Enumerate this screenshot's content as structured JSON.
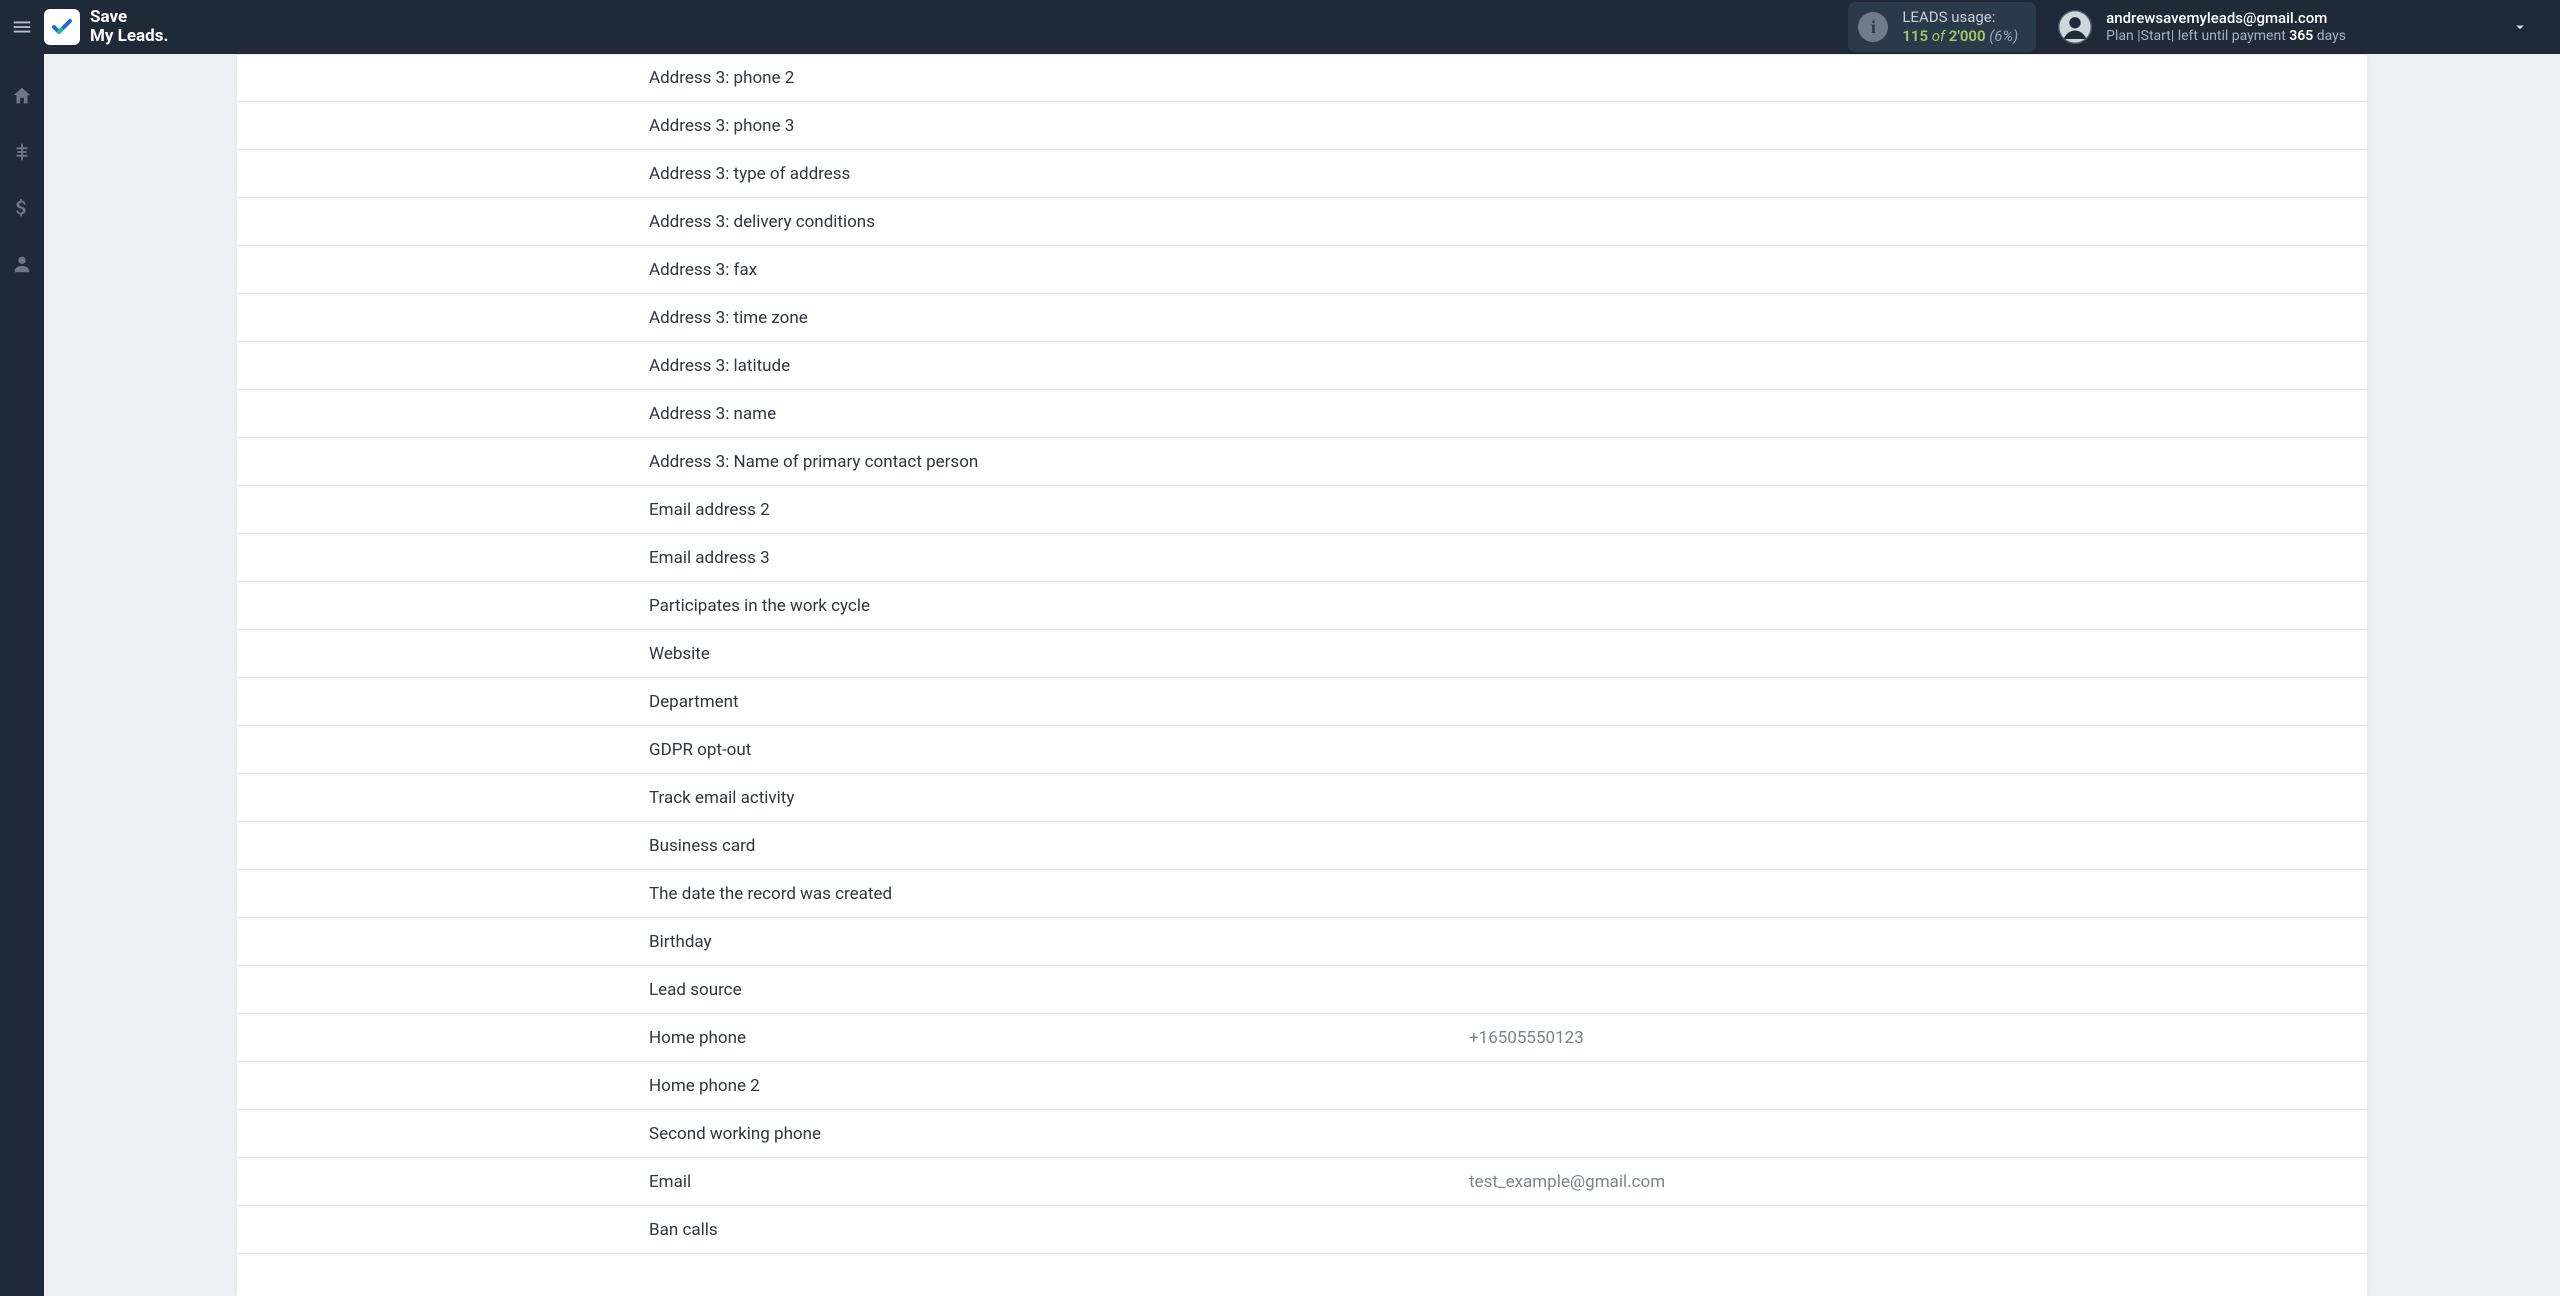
{
  "header": {
    "logo": "Save\nMy Leads.",
    "leads": {
      "label": "LEADS usage:",
      "used": "115",
      "of": " of ",
      "limit": "2'000",
      "pct": "(6%)"
    },
    "user": {
      "email": "andrewsavemyleads@gmail.com",
      "plan_prefix": "Plan |Start| left until payment ",
      "plan_days": "365",
      "plan_suffix": " days"
    }
  },
  "fields": [
    {
      "label": "Address 3: phone 2",
      "value": ""
    },
    {
      "label": "Address 3: phone 3",
      "value": ""
    },
    {
      "label": "Address 3: type of address",
      "value": ""
    },
    {
      "label": "Address 3: delivery conditions",
      "value": ""
    },
    {
      "label": "Address 3: fax",
      "value": ""
    },
    {
      "label": "Address 3: time zone",
      "value": ""
    },
    {
      "label": "Address 3: latitude",
      "value": ""
    },
    {
      "label": "Address 3: name",
      "value": ""
    },
    {
      "label": "Address 3: Name of primary contact person",
      "value": ""
    },
    {
      "label": "Email address 2",
      "value": ""
    },
    {
      "label": "Email address 3",
      "value": ""
    },
    {
      "label": "Participates in the work cycle",
      "value": ""
    },
    {
      "label": "Website",
      "value": ""
    },
    {
      "label": "Department",
      "value": ""
    },
    {
      "label": "GDPR opt-out",
      "value": ""
    },
    {
      "label": "Track email activity",
      "value": ""
    },
    {
      "label": "Business card",
      "value": ""
    },
    {
      "label": "The date the record was created",
      "value": ""
    },
    {
      "label": "Birthday",
      "value": ""
    },
    {
      "label": "Lead source",
      "value": ""
    },
    {
      "label": "Home phone",
      "value": "+16505550123"
    },
    {
      "label": "Home phone 2",
      "value": ""
    },
    {
      "label": "Second working phone",
      "value": ""
    },
    {
      "label": "Email",
      "value": "test_example@gmail.com"
    },
    {
      "label": "Ban calls",
      "value": ""
    }
  ]
}
